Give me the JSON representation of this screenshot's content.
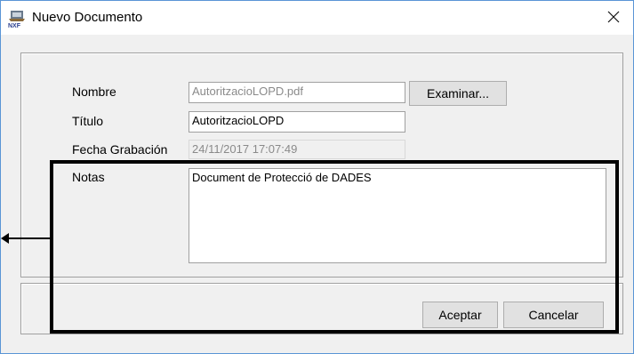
{
  "window": {
    "title": "Nuevo Documento",
    "app_icon": "nxf-app-icon",
    "close_glyph": "✕"
  },
  "form": {
    "nombre_label": "Nombre",
    "nombre_value": "AutoritzacioLOPD.pdf",
    "examinar_label": "Examinar...",
    "titulo_label": "Título",
    "titulo_value": "AutoritzacioLOPD",
    "fecha_label": "Fecha Grabación",
    "fecha_value": "24/11/2017 17:07:49",
    "notas_label": "Notas",
    "notas_value": "Document de Protecció de DADES"
  },
  "buttons": {
    "aceptar": "Aceptar",
    "cancelar": "Cancelar"
  },
  "annotation": {
    "highlight_color": "#000000",
    "arrow_icon": "arrow-left-icon"
  }
}
